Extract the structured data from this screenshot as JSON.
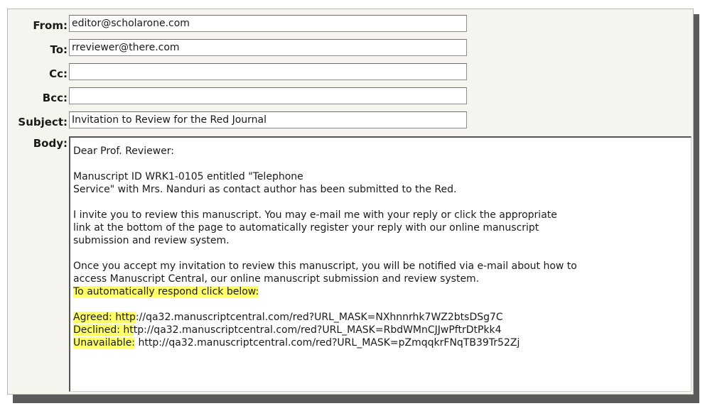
{
  "form": {
    "from": {
      "label": "From:",
      "value": "editor@scholarone.com"
    },
    "to": {
      "label": "To:",
      "value": "rreviewer@there.com"
    },
    "cc": {
      "label": "Cc:",
      "value": ""
    },
    "bcc": {
      "label": "Bcc:",
      "value": ""
    },
    "subject": {
      "label": "Subject:",
      "value": "Invitation to Review for the Red Journal"
    },
    "body_label": "Body:"
  },
  "body": {
    "greeting": "Dear Prof. Reviewer:",
    "para1": [
      "Manuscript ID WRK1-0105 entitled \"Telephone",
      "Service\" with Mrs. Nanduri as contact author has been submitted to the Red."
    ],
    "para2": [
      "I invite you to review this manuscript. You may e-mail me with your reply or click the appropriate",
      "link at the bottom of the page to automatically register your reply with our online manuscript",
      "submission and review system."
    ],
    "para3": [
      "Once you accept my invitation to review this manuscript, you will be notified via e-mail about how to",
      "access Manuscript Central, our online manuscript submission and review system."
    ],
    "respond_instruction": "To automatically respond click below:",
    "links": {
      "agreed": {
        "highlight": "Agreed: http",
        "rest": "://qa32.manuscriptcentral.com/red?URL_MASK=NXhnnrhk7WZ2btsDSg7C"
      },
      "declined": {
        "highlight": "Declined: ht",
        "rest": "tp://qa32.manuscriptcentral.com/red?URL_MASK=RbdWMnCJJwPftrDtPkk4"
      },
      "unavailable": {
        "highlight": "Unavailable:",
        "rest": " http://qa32.manuscriptcentral.com/red?URL_MASK=pZmqqkrFNqTB39Tr52Zj"
      }
    }
  },
  "colors": {
    "panel_bg": "#f5f4ee",
    "highlight": "#ffff66",
    "shadow": "#5b5b5b"
  }
}
